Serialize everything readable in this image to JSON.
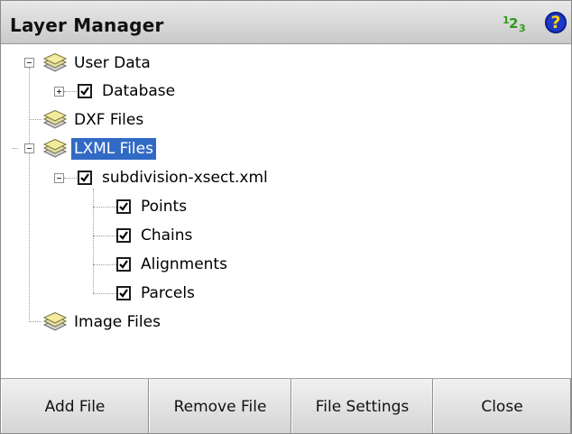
{
  "window": {
    "title": "Layer Manager",
    "number_icon": {
      "d1": "1",
      "d2": "2",
      "d3": "3"
    },
    "help_icon": "?"
  },
  "tree": {
    "user_data": "User Data",
    "database": "Database",
    "dxf_files": "DXF Files",
    "lxml_files": "LXML Files",
    "xml_file": "subdivision-xsect.xml",
    "points": "Points",
    "chains": "Chains",
    "alignments": "Alignments",
    "parcels": "Parcels",
    "image_files": "Image Files"
  },
  "buttons": {
    "add_file": "Add File",
    "remove_file": "Remove File",
    "file_settings": "File Settings",
    "close": "Close"
  },
  "colors": {
    "selection": "#316ac5",
    "number_icon": "#2f9a19",
    "help_icon": "#1e38c9"
  }
}
